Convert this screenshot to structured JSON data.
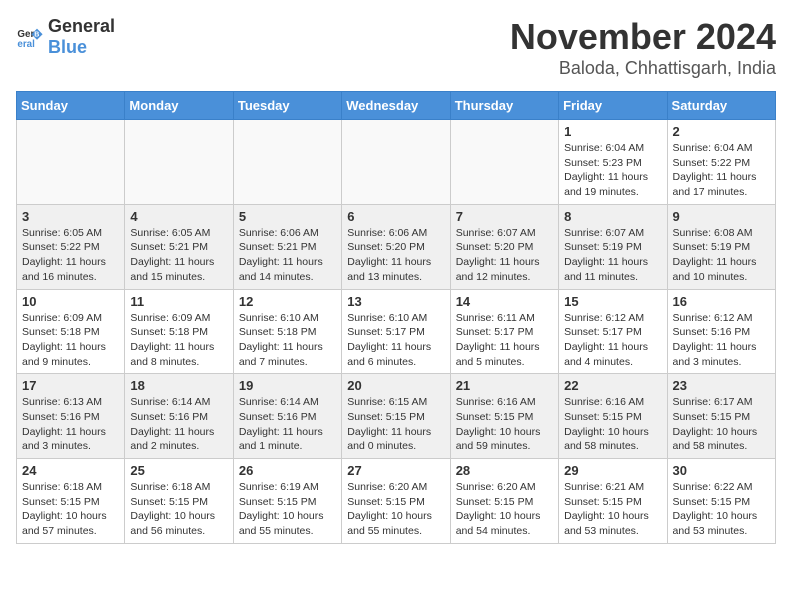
{
  "header": {
    "logo_general": "General",
    "logo_blue": "Blue",
    "month_title": "November 2024",
    "location": "Baloda, Chhattisgarh, India"
  },
  "days_of_week": [
    "Sunday",
    "Monday",
    "Tuesday",
    "Wednesday",
    "Thursday",
    "Friday",
    "Saturday"
  ],
  "weeks": [
    [
      {
        "day": "",
        "info": ""
      },
      {
        "day": "",
        "info": ""
      },
      {
        "day": "",
        "info": ""
      },
      {
        "day": "",
        "info": ""
      },
      {
        "day": "",
        "info": ""
      },
      {
        "day": "1",
        "info": "Sunrise: 6:04 AM\nSunset: 5:23 PM\nDaylight: 11 hours and 19 minutes."
      },
      {
        "day": "2",
        "info": "Sunrise: 6:04 AM\nSunset: 5:22 PM\nDaylight: 11 hours and 17 minutes."
      }
    ],
    [
      {
        "day": "3",
        "info": "Sunrise: 6:05 AM\nSunset: 5:22 PM\nDaylight: 11 hours and 16 minutes."
      },
      {
        "day": "4",
        "info": "Sunrise: 6:05 AM\nSunset: 5:21 PM\nDaylight: 11 hours and 15 minutes."
      },
      {
        "day": "5",
        "info": "Sunrise: 6:06 AM\nSunset: 5:21 PM\nDaylight: 11 hours and 14 minutes."
      },
      {
        "day": "6",
        "info": "Sunrise: 6:06 AM\nSunset: 5:20 PM\nDaylight: 11 hours and 13 minutes."
      },
      {
        "day": "7",
        "info": "Sunrise: 6:07 AM\nSunset: 5:20 PM\nDaylight: 11 hours and 12 minutes."
      },
      {
        "day": "8",
        "info": "Sunrise: 6:07 AM\nSunset: 5:19 PM\nDaylight: 11 hours and 11 minutes."
      },
      {
        "day": "9",
        "info": "Sunrise: 6:08 AM\nSunset: 5:19 PM\nDaylight: 11 hours and 10 minutes."
      }
    ],
    [
      {
        "day": "10",
        "info": "Sunrise: 6:09 AM\nSunset: 5:18 PM\nDaylight: 11 hours and 9 minutes."
      },
      {
        "day": "11",
        "info": "Sunrise: 6:09 AM\nSunset: 5:18 PM\nDaylight: 11 hours and 8 minutes."
      },
      {
        "day": "12",
        "info": "Sunrise: 6:10 AM\nSunset: 5:18 PM\nDaylight: 11 hours and 7 minutes."
      },
      {
        "day": "13",
        "info": "Sunrise: 6:10 AM\nSunset: 5:17 PM\nDaylight: 11 hours and 6 minutes."
      },
      {
        "day": "14",
        "info": "Sunrise: 6:11 AM\nSunset: 5:17 PM\nDaylight: 11 hours and 5 minutes."
      },
      {
        "day": "15",
        "info": "Sunrise: 6:12 AM\nSunset: 5:17 PM\nDaylight: 11 hours and 4 minutes."
      },
      {
        "day": "16",
        "info": "Sunrise: 6:12 AM\nSunset: 5:16 PM\nDaylight: 11 hours and 3 minutes."
      }
    ],
    [
      {
        "day": "17",
        "info": "Sunrise: 6:13 AM\nSunset: 5:16 PM\nDaylight: 11 hours and 3 minutes."
      },
      {
        "day": "18",
        "info": "Sunrise: 6:14 AM\nSunset: 5:16 PM\nDaylight: 11 hours and 2 minutes."
      },
      {
        "day": "19",
        "info": "Sunrise: 6:14 AM\nSunset: 5:16 PM\nDaylight: 11 hours and 1 minute."
      },
      {
        "day": "20",
        "info": "Sunrise: 6:15 AM\nSunset: 5:15 PM\nDaylight: 11 hours and 0 minutes."
      },
      {
        "day": "21",
        "info": "Sunrise: 6:16 AM\nSunset: 5:15 PM\nDaylight: 10 hours and 59 minutes."
      },
      {
        "day": "22",
        "info": "Sunrise: 6:16 AM\nSunset: 5:15 PM\nDaylight: 10 hours and 58 minutes."
      },
      {
        "day": "23",
        "info": "Sunrise: 6:17 AM\nSunset: 5:15 PM\nDaylight: 10 hours and 58 minutes."
      }
    ],
    [
      {
        "day": "24",
        "info": "Sunrise: 6:18 AM\nSunset: 5:15 PM\nDaylight: 10 hours and 57 minutes."
      },
      {
        "day": "25",
        "info": "Sunrise: 6:18 AM\nSunset: 5:15 PM\nDaylight: 10 hours and 56 minutes."
      },
      {
        "day": "26",
        "info": "Sunrise: 6:19 AM\nSunset: 5:15 PM\nDaylight: 10 hours and 55 minutes."
      },
      {
        "day": "27",
        "info": "Sunrise: 6:20 AM\nSunset: 5:15 PM\nDaylight: 10 hours and 55 minutes."
      },
      {
        "day": "28",
        "info": "Sunrise: 6:20 AM\nSunset: 5:15 PM\nDaylight: 10 hours and 54 minutes."
      },
      {
        "day": "29",
        "info": "Sunrise: 6:21 AM\nSunset: 5:15 PM\nDaylight: 10 hours and 53 minutes."
      },
      {
        "day": "30",
        "info": "Sunrise: 6:22 AM\nSunset: 5:15 PM\nDaylight: 10 hours and 53 minutes."
      }
    ]
  ]
}
